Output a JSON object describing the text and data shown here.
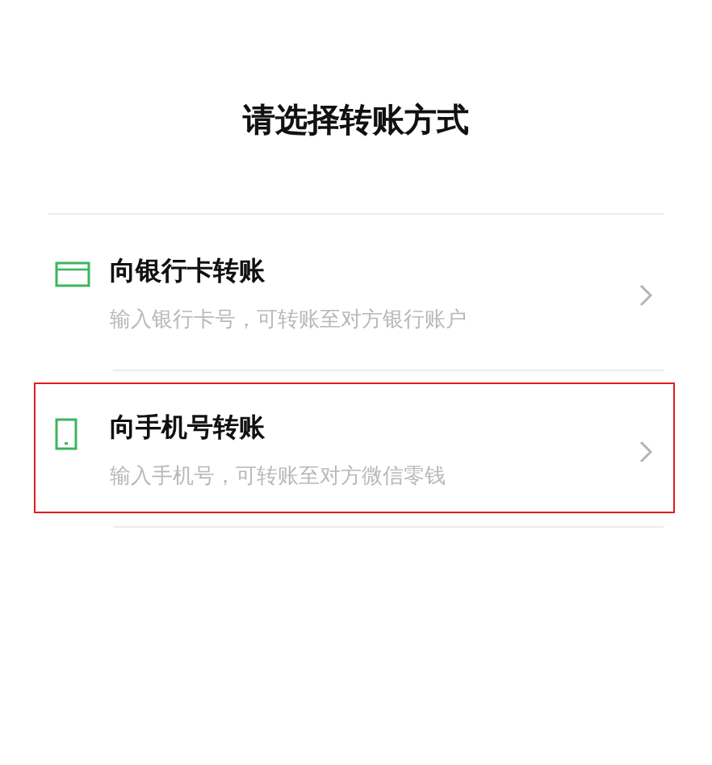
{
  "title": "请选择转账方式",
  "options": [
    {
      "kind": "card",
      "label": "向银行卡转账",
      "description": "输入银行卡号，可转账至对方银行账户",
      "highlighted": false
    },
    {
      "kind": "phone",
      "label": "向手机号转账",
      "description": "输入手机号，可转账至对方微信零钱",
      "highlighted": true
    }
  ]
}
